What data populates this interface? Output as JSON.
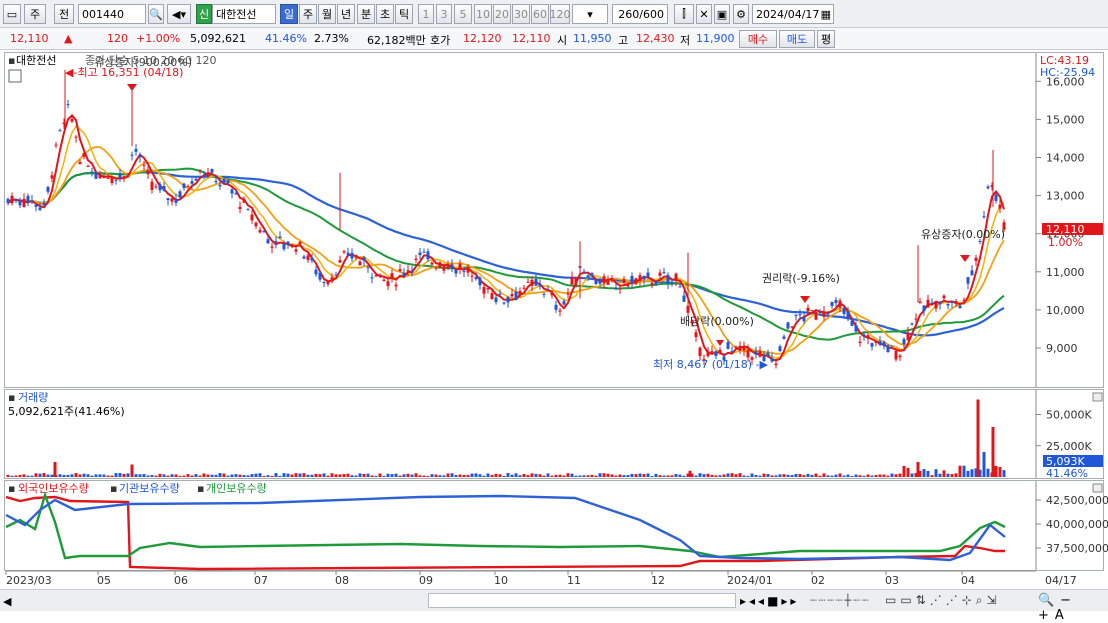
{
  "toolbar": {
    "type_btn": "주",
    "prev_btn": "전",
    "code": "001440",
    "name_badge": "신",
    "name": "대한전선",
    "periods": [
      "일",
      "주",
      "월",
      "년",
      "분",
      "초",
      "틱"
    ],
    "nums": [
      "1",
      "3",
      "5",
      "10",
      "20",
      "30",
      "60",
      "120"
    ],
    "count": "260",
    "total": "/600",
    "date": "2024/04/17"
  },
  "quote": {
    "price": "12,110",
    "change": "120",
    "pct": "+1.00%",
    "volume": "5,092,621",
    "vol_ratio": "41.46%",
    "turnover": "2.73%",
    "amount": "62,182백만",
    "ask_label": "호가",
    "ask": "12,120",
    "bid": "12,110",
    "open_label": "시",
    "open": "11,950",
    "high_label": "고",
    "high": "12,430",
    "low_label": "저",
    "low": "11,900",
    "buy": "매수",
    "sell": "매도",
    "eval": "평"
  },
  "price_panel": {
    "legend_name": "대한전선",
    "legend_ma": "종가 단순 5 10 20 60 120",
    "legend_overlap": "유상증자(900.00%)",
    "lc": "LC:43.19",
    "hc": "HC:-25.94",
    "high_note": "최고 16,351 (04/18)",
    "low_note": "최저 8,467 (01/18)",
    "ann_rights": "권리락(-9.16%)",
    "ann_div": "배당락(0.00%)",
    "ann_offer": "유상증자(0.00%)",
    "cur_price": "12,110",
    "cur_pct": "1.00%",
    "yticks": [
      "16,000",
      "15,000",
      "14,000",
      "13,000",
      "12,000",
      "11,000",
      "10,000",
      "9,000"
    ]
  },
  "volume_panel": {
    "title": "거래량",
    "value": "5,092,621주(41.46%)",
    "yticks": [
      "50,000K",
      "25,000K"
    ],
    "cur": "5,093K",
    "cur_pct": "41.46%"
  },
  "holdings_panel": {
    "legend": [
      "외국인보유수량",
      "기관보유수량",
      "개인보유수량"
    ],
    "yticks": [
      "42,500,000",
      "40,000,000",
      "37,500,000"
    ]
  },
  "xaxis": [
    "2023/03",
    "05",
    "06",
    "07",
    "08",
    "09",
    "10",
    "11",
    "12",
    "2024/01",
    "02",
    "03",
    "04",
    "04/17"
  ],
  "colors": {
    "up": "#e0161b",
    "down": "#1f57d6",
    "ma5": "#e0161b",
    "ma10": "#f2b411",
    "ma20": "#f2a014",
    "ma60": "#1f9a3a",
    "ma120": "#2d62d6"
  }
}
